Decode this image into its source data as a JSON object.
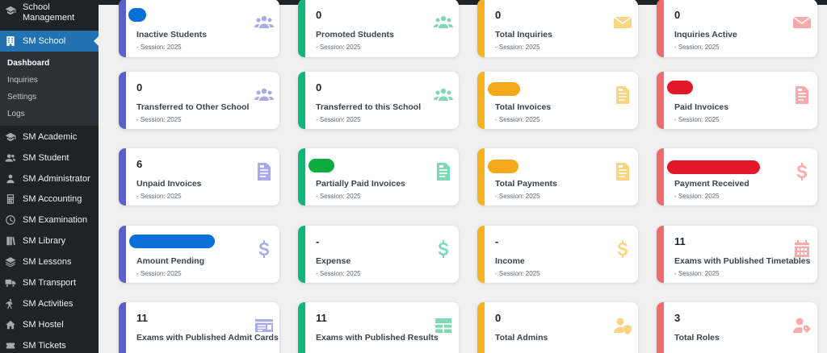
{
  "sidebar": {
    "brand": "School Management",
    "active": "SM School",
    "submenu": [
      "Dashboard",
      "Inquiries",
      "Settings",
      "Logs"
    ],
    "items": [
      {
        "label": "SM Academic",
        "icon": "graduation-cap-icon"
      },
      {
        "label": "SM Student",
        "icon": "users-icon"
      },
      {
        "label": "SM Administrator",
        "icon": "user-tie-icon"
      },
      {
        "label": "SM Accounting",
        "icon": "calculator-icon"
      },
      {
        "label": "SM Examination",
        "icon": "clock-icon"
      },
      {
        "label": "SM Library",
        "icon": "book-icon"
      },
      {
        "label": "SM Lessons",
        "icon": "layers-icon"
      },
      {
        "label": "SM Transport",
        "icon": "truck-icon"
      },
      {
        "label": "SM Activities",
        "icon": "activity-icon"
      },
      {
        "label": "SM Hostel",
        "icon": "home-icon"
      },
      {
        "label": "SM Tickets",
        "icon": "ticket-icon"
      }
    ]
  },
  "colors": {
    "purple": "#5b5fce",
    "green": "#10b57a",
    "yellow": "#f7b01f",
    "red": "#f06b6b",
    "purple_icon": "#a9abe8",
    "green_icon": "#7fd9b7",
    "yellow_icon": "#fbd47f",
    "red_icon": "#f8aaaa",
    "redact_blue": "#0a6fd6",
    "redact_green": "#0bab3d",
    "redact_orange": "#f7a81b",
    "redact_red": "#e3172a"
  },
  "session_label": "- Session: 2025",
  "cards": [
    {
      "value": "",
      "label": "Inactive Students",
      "icon": "users-icon",
      "color": "purple"
    },
    {
      "value": "0",
      "label": "Promoted Students",
      "icon": "users-icon",
      "color": "green"
    },
    {
      "value": "0",
      "label": "Total Inquiries",
      "icon": "envelope-icon",
      "color": "yellow"
    },
    {
      "value": "0",
      "label": "Inquiries Active",
      "icon": "envelope-icon",
      "color": "red"
    },
    {
      "value": "0",
      "label": "Transferred to Other School",
      "icon": "users-icon",
      "color": "purple"
    },
    {
      "value": "0",
      "label": "Transferred to this School",
      "icon": "users-icon",
      "color": "green"
    },
    {
      "value": "",
      "label": "Total Invoices",
      "icon": "invoice-icon",
      "color": "yellow"
    },
    {
      "value": "",
      "label": "Paid Invoices",
      "icon": "invoice-icon",
      "color": "red"
    },
    {
      "value": "6",
      "label": "Unpaid Invoices",
      "icon": "invoice-icon",
      "color": "purple"
    },
    {
      "value": "",
      "label": "Partially Paid Invoices",
      "icon": "invoice-icon",
      "color": "green"
    },
    {
      "value": "",
      "label": "Total Payments",
      "icon": "invoice-icon",
      "color": "yellow"
    },
    {
      "value": "",
      "label": "Payment Received",
      "icon": "dollar-icon",
      "color": "red"
    },
    {
      "value": "",
      "label": "Amount Pending",
      "icon": "dollar-icon",
      "color": "purple"
    },
    {
      "value": "-",
      "label": "Expense",
      "icon": "dollar-icon",
      "color": "green"
    },
    {
      "value": "-",
      "label": "Income",
      "icon": "dollar-icon",
      "color": "yellow"
    },
    {
      "value": "11",
      "label": "Exams with Published Timetables",
      "icon": "calendar-icon",
      "color": "red"
    },
    {
      "value": "11",
      "label": "Exams with Published Admit Cards",
      "icon": "id-card-icon",
      "color": "purple"
    },
    {
      "value": "11",
      "label": "Exams with Published Results",
      "icon": "table-icon",
      "color": "green"
    },
    {
      "value": "0",
      "label": "Total Admins",
      "icon": "user-shield-icon",
      "color": "yellow"
    },
    {
      "value": "3",
      "label": "Total Roles",
      "icon": "user-tag-icon",
      "color": "red"
    }
  ]
}
